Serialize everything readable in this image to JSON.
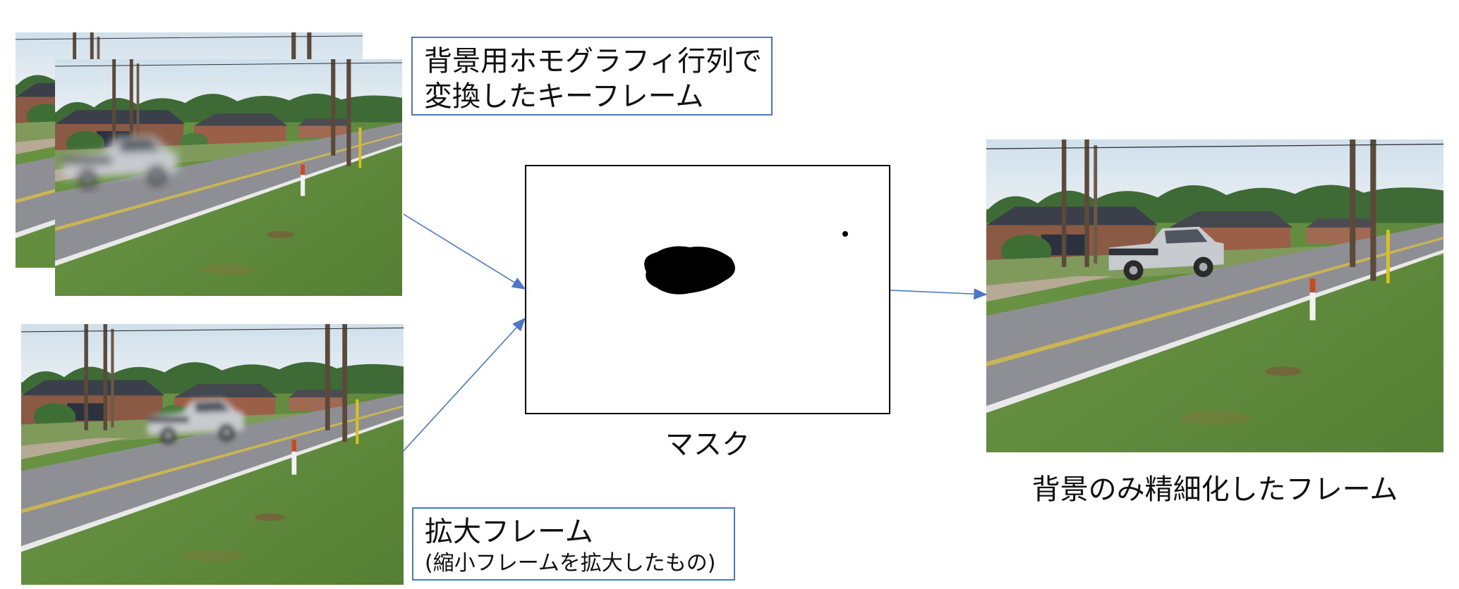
{
  "diagram": {
    "keyframe_label": {
      "line1": "背景用ホモグラフィ行列で",
      "line2": "変換したキーフレーム"
    },
    "upscaled_label": {
      "title": "拡大フレーム",
      "subtitle": "(縮小フレームを拡大したもの)"
    },
    "mask_caption": "マスク",
    "output_caption": "背景のみ精細化したフレーム",
    "colors": {
      "label_border": "#4a78c4",
      "arrow": "#4a78c4",
      "mask_fill": "#000000"
    }
  }
}
